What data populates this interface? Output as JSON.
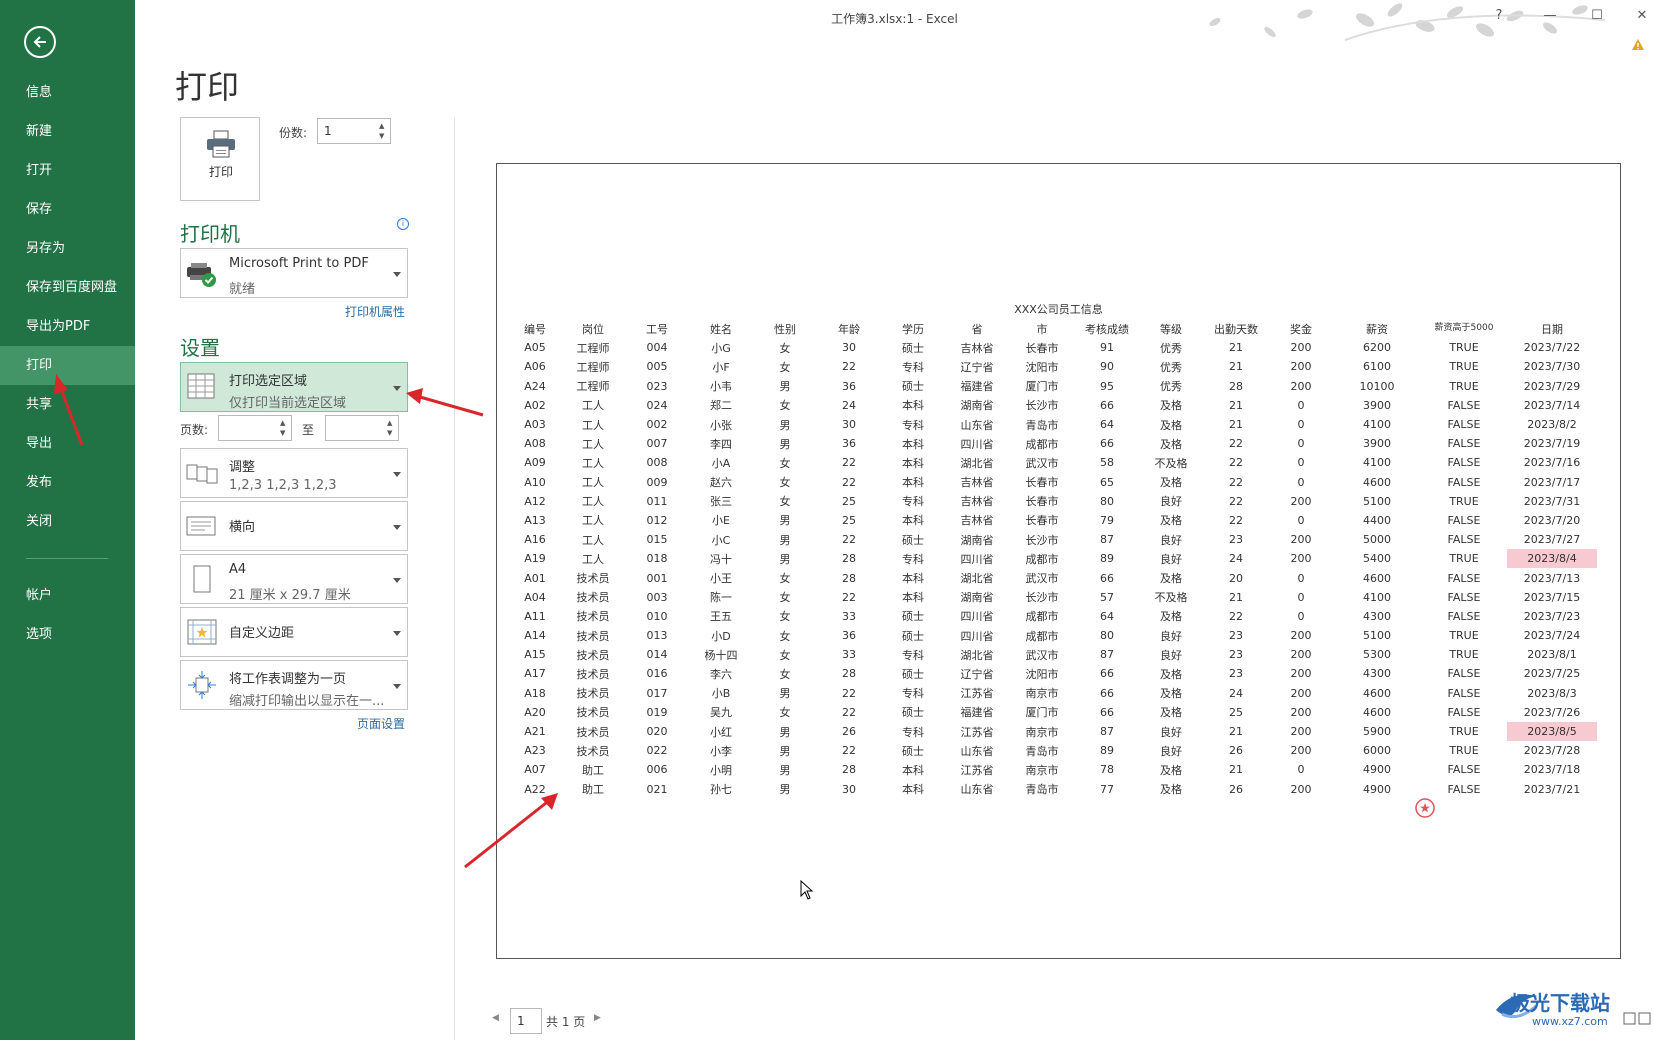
{
  "window": {
    "title": "工作簿3.xlsx:1 - Excel",
    "help_label": "?",
    "minimize_label": "—",
    "restore_label": "☐",
    "close_label": "✕"
  },
  "sidebar": {
    "items": [
      {
        "label": "信息"
      },
      {
        "label": "新建"
      },
      {
        "label": "打开"
      },
      {
        "label": "保存"
      },
      {
        "label": "另存为"
      },
      {
        "label": "保存到百度网盘"
      },
      {
        "label": "导出为PDF"
      },
      {
        "label": "打印",
        "active": true
      },
      {
        "label": "共享"
      },
      {
        "label": "导出"
      },
      {
        "label": "发布"
      },
      {
        "label": "关闭"
      }
    ],
    "bottom_items": [
      {
        "label": "帐户"
      },
      {
        "label": "选项"
      }
    ]
  },
  "print": {
    "page_title": "打印",
    "print_button_label": "打印",
    "copies_label": "份数:",
    "copies_value": "1",
    "printer_heading": "打印机",
    "printer_name": "Microsoft Print to PDF",
    "printer_status": "就绪",
    "printer_properties_link": "打印机属性",
    "settings_heading": "设置",
    "area_title": "打印选定区域",
    "area_desc": "仅打印当前选定区域",
    "pages_label": "页数:",
    "pages_to_label": "至",
    "collate_title": "调整",
    "collate_desc": "1,2,3    1,2,3    1,2,3",
    "orientation_title": "横向",
    "paper_title": "A4",
    "paper_desc": "21 厘米 x 29.7 厘米",
    "margins_title": "自定义边距",
    "scaling_title": "将工作表调整为一页",
    "scaling_desc": "缩减打印输出以显示在一...",
    "page_setup_link": "页面设置"
  },
  "preview": {
    "sheet_title": "XXX公司员工信息",
    "columns": [
      "编号",
      "岗位",
      "工号",
      "姓名",
      "性别",
      "年龄",
      "学历",
      "省",
      "市",
      "考核成绩",
      "等级",
      "出勤天数",
      "奖金",
      "薪资",
      "薪资高于5000",
      "日期"
    ],
    "rows": [
      [
        "A05",
        "工程师",
        "004",
        "小G",
        "女",
        "30",
        "硕士",
        "吉林省",
        "长春市",
        "91",
        "优秀",
        "21",
        "200",
        "6200",
        "TRUE",
        "2023/7/22"
      ],
      [
        "A06",
        "工程师",
        "005",
        "小F",
        "女",
        "22",
        "专科",
        "辽宁省",
        "沈阳市",
        "90",
        "优秀",
        "21",
        "200",
        "6100",
        "TRUE",
        "2023/7/30"
      ],
      [
        "A24",
        "工程师",
        "023",
        "小韦",
        "男",
        "36",
        "硕士",
        "福建省",
        "厦门市",
        "95",
        "优秀",
        "28",
        "200",
        "10100",
        "TRUE",
        "2023/7/29"
      ],
      [
        "A02",
        "工人",
        "024",
        "郑二",
        "女",
        "24",
        "本科",
        "湖南省",
        "长沙市",
        "66",
        "及格",
        "21",
        "0",
        "3900",
        "FALSE",
        "2023/7/14"
      ],
      [
        "A03",
        "工人",
        "002",
        "小张",
        "男",
        "30",
        "专科",
        "山东省",
        "青岛市",
        "64",
        "及格",
        "21",
        "0",
        "4100",
        "FALSE",
        "2023/8/2"
      ],
      [
        "A08",
        "工人",
        "007",
        "李四",
        "男",
        "36",
        "本科",
        "四川省",
        "成都市",
        "66",
        "及格",
        "22",
        "0",
        "3900",
        "FALSE",
        "2023/7/19"
      ],
      [
        "A09",
        "工人",
        "008",
        "小A",
        "女",
        "22",
        "本科",
        "湖北省",
        "武汉市",
        "58",
        "不及格",
        "22",
        "0",
        "4100",
        "FALSE",
        "2023/7/16"
      ],
      [
        "A10",
        "工人",
        "009",
        "赵六",
        "女",
        "22",
        "本科",
        "吉林省",
        "长春市",
        "65",
        "及格",
        "22",
        "0",
        "4600",
        "FALSE",
        "2023/7/17"
      ],
      [
        "A12",
        "工人",
        "011",
        "张三",
        "女",
        "25",
        "专科",
        "吉林省",
        "长春市",
        "80",
        "良好",
        "22",
        "200",
        "5100",
        "TRUE",
        "2023/7/31"
      ],
      [
        "A13",
        "工人",
        "012",
        "小E",
        "男",
        "25",
        "本科",
        "吉林省",
        "长春市",
        "79",
        "及格",
        "22",
        "0",
        "4400",
        "FALSE",
        "2023/7/20"
      ],
      [
        "A16",
        "工人",
        "015",
        "小C",
        "男",
        "22",
        "硕士",
        "湖南省",
        "长沙市",
        "87",
        "良好",
        "23",
        "200",
        "5000",
        "FALSE",
        "2023/7/27"
      ],
      [
        "A19",
        "工人",
        "018",
        "冯十",
        "男",
        "28",
        "专科",
        "四川省",
        "成都市",
        "89",
        "良好",
        "24",
        "200",
        "5400",
        "TRUE",
        "2023/8/4"
      ],
      [
        "A01",
        "技术员",
        "001",
        "小王",
        "女",
        "28",
        "本科",
        "湖北省",
        "武汉市",
        "66",
        "及格",
        "20",
        "0",
        "4600",
        "FALSE",
        "2023/7/13"
      ],
      [
        "A04",
        "技术员",
        "003",
        "陈一",
        "女",
        "22",
        "本科",
        "湖南省",
        "长沙市",
        "57",
        "不及格",
        "21",
        "0",
        "4100",
        "FALSE",
        "2023/7/15"
      ],
      [
        "A11",
        "技术员",
        "010",
        "王五",
        "女",
        "33",
        "硕士",
        "四川省",
        "成都市",
        "64",
        "及格",
        "22",
        "0",
        "4300",
        "FALSE",
        "2023/7/23"
      ],
      [
        "A14",
        "技术员",
        "013",
        "小D",
        "女",
        "36",
        "硕士",
        "四川省",
        "成都市",
        "80",
        "良好",
        "23",
        "200",
        "5100",
        "TRUE",
        "2023/7/24"
      ],
      [
        "A15",
        "技术员",
        "014",
        "杨十四",
        "女",
        "33",
        "专科",
        "湖北省",
        "武汉市",
        "87",
        "良好",
        "23",
        "200",
        "5300",
        "TRUE",
        "2023/8/1"
      ],
      [
        "A17",
        "技术员",
        "016",
        "李六",
        "女",
        "28",
        "硕士",
        "辽宁省",
        "沈阳市",
        "66",
        "及格",
        "23",
        "200",
        "4300",
        "FALSE",
        "2023/7/25"
      ],
      [
        "A18",
        "技术员",
        "017",
        "小B",
        "男",
        "22",
        "专科",
        "江苏省",
        "南京市",
        "66",
        "及格",
        "24",
        "200",
        "4600",
        "FALSE",
        "2023/8/3"
      ],
      [
        "A20",
        "技术员",
        "019",
        "吴九",
        "女",
        "22",
        "硕士",
        "福建省",
        "厦门市",
        "66",
        "及格",
        "25",
        "200",
        "4600",
        "FALSE",
        "2023/7/26"
      ],
      [
        "A21",
        "技术员",
        "020",
        "小红",
        "男",
        "26",
        "专科",
        "江苏省",
        "南京市",
        "87",
        "良好",
        "21",
        "200",
        "5900",
        "TRUE",
        "2023/8/5"
      ],
      [
        "A23",
        "技术员",
        "022",
        "小李",
        "男",
        "22",
        "硕士",
        "山东省",
        "青岛市",
        "89",
        "良好",
        "26",
        "200",
        "6000",
        "TRUE",
        "2023/7/28"
      ],
      [
        "A07",
        "助工",
        "006",
        "小明",
        "男",
        "28",
        "本科",
        "江苏省",
        "南京市",
        "78",
        "及格",
        "21",
        "0",
        "4900",
        "FALSE",
        "2023/7/18"
      ],
      [
        "A22",
        "助工",
        "021",
        "孙七",
        "男",
        "30",
        "本科",
        "山东省",
        "青岛市",
        "77",
        "及格",
        "26",
        "200",
        "4900",
        "FALSE",
        "2023/7/21"
      ]
    ],
    "highlighted_dates": [
      "2023/8/4",
      "2023/8/5"
    ],
    "highlight_color": "#f7c9d0"
  },
  "footer": {
    "page_value": "1",
    "page_total": "共 1 页",
    "prev_icon": "◀",
    "next_icon": "▶"
  },
  "watermark": {
    "name": "极光下载站",
    "url": "www.xz7.com"
  },
  "colors": {
    "sidebar": "#217346",
    "sidebar_active": "#439467",
    "accent": "#217346",
    "selection": "#cfe8d8",
    "annotation_arrow": "#d9262b"
  }
}
